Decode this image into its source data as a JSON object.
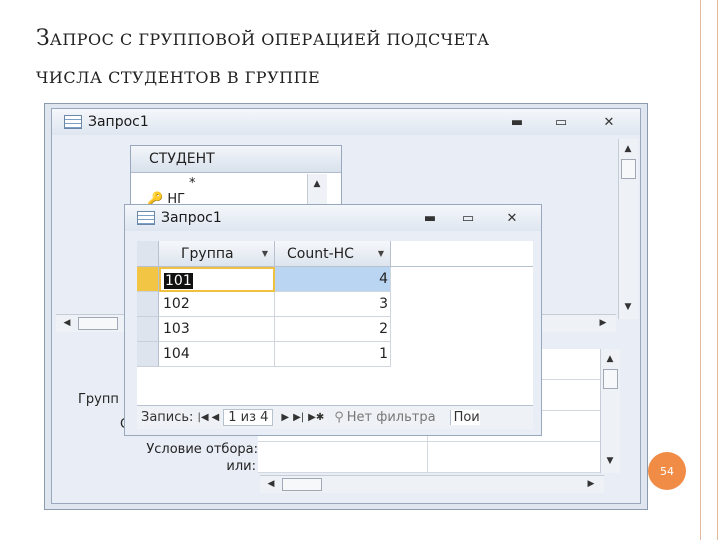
{
  "slide": {
    "title_line1_cap": "З",
    "title_line1_rest": "АПРОС С ГРУППОВОЙ ОПЕРАЦИЕЙ ПОДСЧЕТА",
    "title_line2": "ЧИСЛА СТУДЕНТОВ В ГРУППЕ",
    "page_number": "54",
    "accent_color": "#f08c46"
  },
  "designer": {
    "window_title": "Запрос1",
    "controls": {
      "minimize": "▬",
      "restore": "▭",
      "close": "✕"
    },
    "table": {
      "name": "СТУДЕНТ",
      "fields": [
        "*",
        "НГ"
      ]
    },
    "grid_labels": {
      "group": "Групп",
      "sort": "С",
      "criteria": "Условие отбора:",
      "or": "или:"
    }
  },
  "datasheet": {
    "window_title": "Запрос1",
    "columns": [
      {
        "label": "Группа"
      },
      {
        "label": "Count-НС"
      }
    ],
    "rows": [
      {
        "group": "101",
        "count": "4"
      },
      {
        "group": "102",
        "count": "3"
      },
      {
        "group": "103",
        "count": "2"
      },
      {
        "group": "104",
        "count": "1"
      }
    ],
    "nav": {
      "record_label": "Запись:",
      "position": "1 из 4",
      "filter": "Нет фильтра",
      "search": "Пои"
    }
  }
}
